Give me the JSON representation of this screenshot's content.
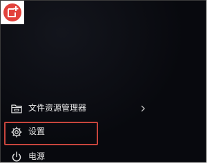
{
  "start_menu": {
    "logo_icon": "sticky-note-logo-icon",
    "accent_color": "#e2413b",
    "items": [
      {
        "label": "文件资源管理器",
        "icon": "folder-icon",
        "has_submenu": true
      },
      {
        "label": "设置",
        "icon": "gear-icon",
        "highlighted": true
      },
      {
        "label": "电源",
        "icon": "power-icon"
      }
    ],
    "highlight_color": "#c8453d"
  }
}
